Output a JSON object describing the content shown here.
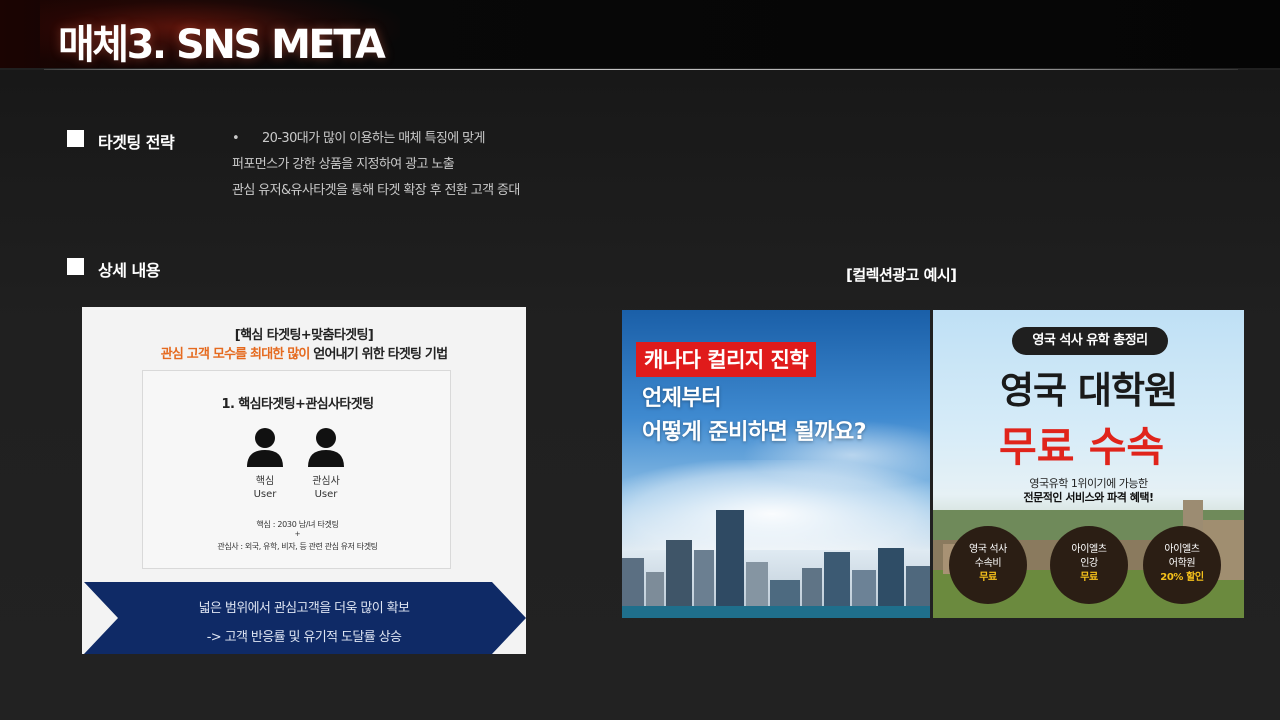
{
  "header": {
    "title": "매체3. SNS META"
  },
  "strategy": {
    "label": "타겟팅 전략",
    "bullet": "•",
    "lines": [
      "20-30대가 많이 이용하는 매체 특징에 맞게",
      "퍼포먼스가 강한 상품을 지정하여 광고 노출",
      "관심 유저&유사타겟을 통해 타겟 확장 후 전환 고객 증대"
    ]
  },
  "detail": {
    "label": "상세 내용",
    "heading": "[핵심 타겟팅+맞춤타겟팅]",
    "subheading_highlight": "관심 고객 모수를 최대한 많이",
    "subheading_rest": " 얻어내기 위한 타겟팅 기법",
    "box_title": "1. 핵심타겟팅+관심사타겟팅",
    "persons": [
      {
        "line1": "핵심",
        "line2": "User"
      },
      {
        "line1": "관심사",
        "line2": "User"
      }
    ],
    "note_core": "핵심 : 2030 남/녀 타겟팅",
    "note_plus": "+",
    "note_interest": "관심사 : 외국, 유학, 비자, 등 관련 관심 유저 타겟팅",
    "banner_line1": "넓은 범위에서 관심고객을 더욱 많이 확보",
    "banner_line2": "-> 고객 반응률 및 유기적 도달률 상승"
  },
  "examples": {
    "label": "[컬렉션광고 예시]",
    "ad1": {
      "highlight": "캐나다 컬리지 진학",
      "line2": "언제부터",
      "line3": "어떻게 준비하면 될까요?"
    },
    "ad2": {
      "pill": "영국 석사 유학 총정리",
      "headline1": "영국 대학원",
      "headline2": "무료 수속",
      "sub1": "영국유학 1위이기에 가능한",
      "sub2": "전문적인 서비스와 파격 혜택!",
      "badges": [
        {
          "line1": "영국 석사",
          "line2": "수속비",
          "highlight": "무료"
        },
        {
          "line1": "아이엘츠",
          "line2": "인강",
          "highlight": "무료"
        },
        {
          "line1": "아이엘츠",
          "line2": "어학원",
          "highlight": "20% 할인"
        }
      ]
    }
  },
  "colors": {
    "accent_orange": "#e56a1f",
    "banner_navy": "#0f2a66",
    "ad_red": "#e01b1b"
  }
}
